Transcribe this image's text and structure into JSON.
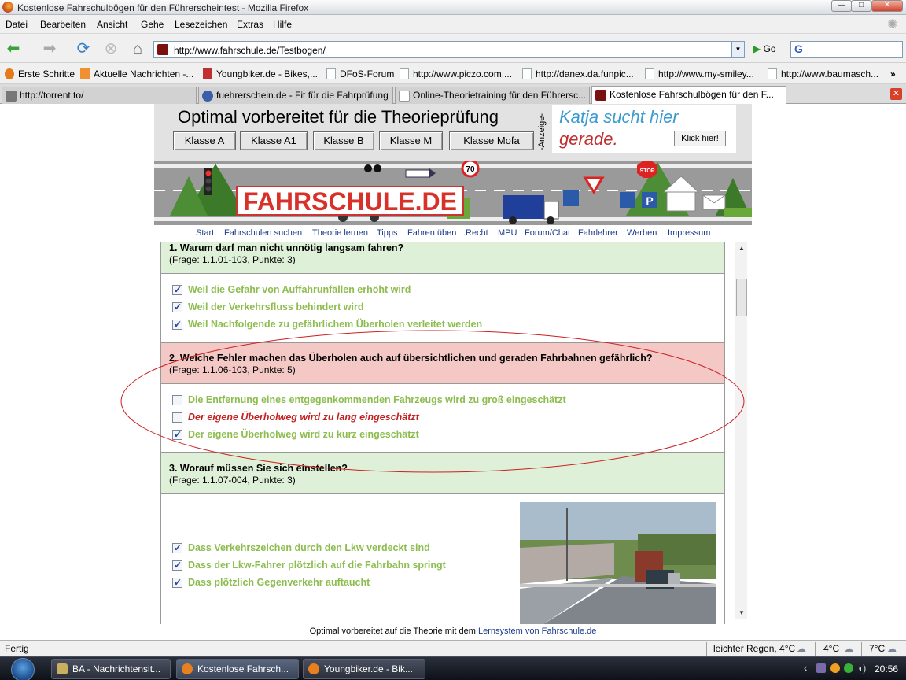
{
  "window": {
    "title": "Kostenlose Fahrschulbögen für den Führerscheintest - Mozilla Firefox",
    "min": "—",
    "max": "□",
    "close": "✕"
  },
  "menu": [
    "Datei",
    "Bearbeiten",
    "Ansicht",
    "Gehe",
    "Lesezeichen",
    "Extras",
    "Hilfe"
  ],
  "nav": {
    "url": "http://www.fahrschule.de/Testbogen/",
    "go_label": "Go",
    "search_engine": "G"
  },
  "bookmarks": [
    "Erste Schritte",
    "Aktuelle Nachrichten -...",
    "Youngbiker.de - Bikes,...",
    "DFoS-Forum",
    "http://www.piczo.com....",
    "http://danex.da.funpic...",
    "http://www.my-smiley...",
    "http://www.baumasch..."
  ],
  "tabs": [
    {
      "label": "http://torrent.to/"
    },
    {
      "label": "fuehrerschein.de - Fit für die Fahrprüfung"
    },
    {
      "label": "Online-Theorietraining für den Führersc..."
    },
    {
      "label": "Kostenlose Fahrschulbögen für den F..."
    }
  ],
  "header": {
    "headline": "Optimal vorbereitet für die Theorieprüfung",
    "classes": [
      "Klasse A",
      "Klasse A1",
      "Klasse B",
      "Klasse M",
      "Klasse Mofa"
    ],
    "anzeige": "-Anzeige-",
    "ad_line1": "Katja sucht hier",
    "ad_line2": "gerade.",
    "ad_button": "Klick hier!"
  },
  "banner": {
    "logo": "FAHRSCHULE.DE",
    "speed_sign": "70",
    "stop_sign": "STOP",
    "parking": "P"
  },
  "sitenav": [
    "Start",
    "Fahrschulen suchen",
    "Theorie lernen",
    "Tipps",
    "Fahren üben",
    "Recht",
    "MPU",
    "Forum/Chat",
    "Fahrlehrer",
    "Werben",
    "Impressum"
  ],
  "questions": [
    {
      "title": "1.  Warum darf man nicht unnötig langsam fahren?",
      "sub": "(Frage: 1.1.01-103, Punkte: 3)",
      "status": "correct",
      "answers": [
        {
          "text": "Weil die Gefahr von Auffahrunfällen erhöht wird",
          "checked": true
        },
        {
          "text": "Weil der Verkehrsfluss behindert wird",
          "checked": true
        },
        {
          "text": "Weil Nachfolgende zu gefährlichem Überholen verleitet werden",
          "checked": true
        }
      ]
    },
    {
      "title": "2.  Welche Fehler machen das Überholen auch auf übersichtlichen und geraden Fahrbahnen gefährlich?",
      "sub": "(Frage: 1.1.06-103, Punkte: 5)",
      "status": "wrong",
      "answers": [
        {
          "text": "Die Entfernung eines entgegenkommenden Fahrzeugs wird zu groß eingeschätzt",
          "checked": false
        },
        {
          "text": "Der eigene Überholweg wird zu lang eingeschätzt",
          "checked": false
        },
        {
          "text": "Der eigene Überholweg wird zu kurz eingeschätzt",
          "checked": true
        }
      ]
    },
    {
      "title": "3.  Worauf müssen Sie sich einstellen?",
      "sub": "(Frage: 1.1.07-004, Punkte: 3)",
      "status": "correct",
      "answers": [
        {
          "text": "Dass Verkehrszeichen durch den Lkw verdeckt sind",
          "checked": true
        },
        {
          "text": "Dass der Lkw-Fahrer plötzlich auf die Fahrbahn springt",
          "checked": true
        },
        {
          "text": "Dass plötzlich Gegenverkehr auftaucht",
          "checked": true
        }
      ]
    }
  ],
  "footer": {
    "prefix": "Optimal vorbereitet auf die Theorie mit dem ",
    "link": "Lernsystem von Fahrschule.de"
  },
  "status": {
    "text": "Fertig",
    "weather1": "leichter Regen, 4°C",
    "weather2": "4°C",
    "weather3": "7°C"
  },
  "taskbar": {
    "tasks": [
      "BA - Nachrichtensit...",
      "Kostenlose Fahrsch...",
      "Youngbiker.de - Bik..."
    ],
    "clock": "20:56"
  },
  "colors": {
    "correct_bg": "#dff0d8",
    "wrong_bg": "#f4c8c5",
    "answer_green": "#8dbd4f",
    "answer_red": "#c42121",
    "annotation": "#cc1f1f"
  }
}
